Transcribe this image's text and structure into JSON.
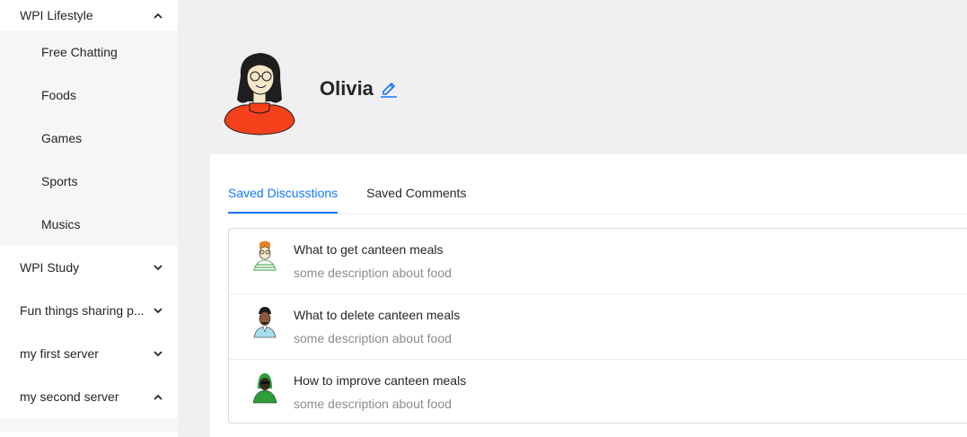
{
  "sidebar": {
    "groups": [
      {
        "label": "WPI Lifestyle",
        "expanded": true,
        "items": [
          "Free Chatting",
          "Foods",
          "Games",
          "Sports",
          "Musics"
        ]
      },
      {
        "label": "WPI Study",
        "expanded": false
      },
      {
        "label": "Fun things sharing p...",
        "expanded": false
      },
      {
        "label": "my first server",
        "expanded": false
      },
      {
        "label": "my second server",
        "expanded": true
      }
    ]
  },
  "profile": {
    "name": "Olivia"
  },
  "tabs": [
    {
      "label": "Saved Discusstions",
      "active": true
    },
    {
      "label": "Saved Comments",
      "active": false
    }
  ],
  "discussions": [
    {
      "title": "What to get canteen meals",
      "description": "some description about food",
      "avatar_icon": "woman-glasses-avatar-icon"
    },
    {
      "title": "What to delete canteen meals",
      "description": "some description about food",
      "avatar_icon": "man-blue-shirt-avatar-icon"
    },
    {
      "title": "How to improve canteen meals",
      "description": "some description about food",
      "avatar_icon": "green-hood-avatar-icon"
    }
  ],
  "colors": {
    "accent": "#1677ff",
    "avatar_shirt": "#f5401c",
    "background": "#f0f0f3"
  }
}
